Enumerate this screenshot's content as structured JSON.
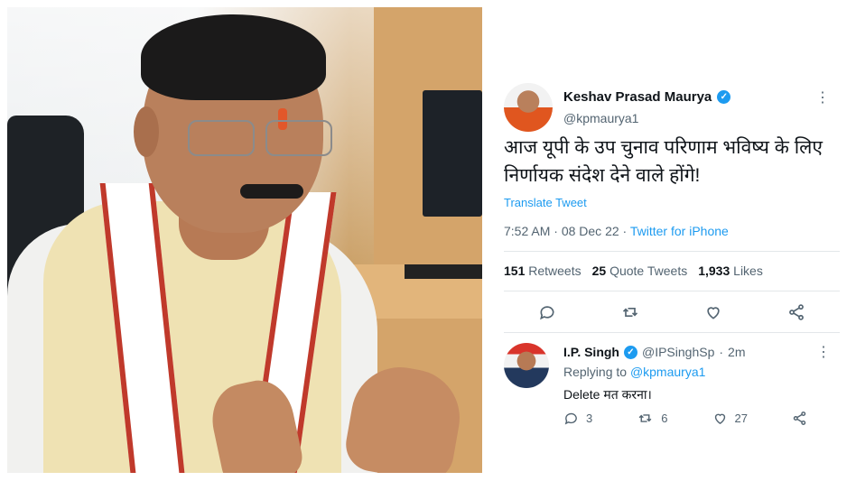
{
  "tweet": {
    "author_name": "Keshav Prasad Maurya",
    "author_handle": "@kpmaurya1",
    "text": "आज यूपी के उप चुनाव परिणाम भविष्य के लिए निर्णायक संदेश देने वाले होंगे!",
    "translate_label": "Translate Tweet",
    "time": "7:52 AM",
    "separator": " · ",
    "date": "08 Dec 22",
    "source": "Twitter for iPhone",
    "stats": {
      "retweets_count": "151",
      "retweets_label": "Retweets",
      "quotes_count": "25",
      "quotes_label": "Quote Tweets",
      "likes_count": "1,933",
      "likes_label": "Likes"
    },
    "actions": [
      "reply-icon",
      "retweet-icon",
      "like-icon",
      "share-icon"
    ]
  },
  "reply": {
    "author_name": "I.P. Singh",
    "author_handle": "@IPSinghSp",
    "dot": "·",
    "age": "2m",
    "replying_label": "Replying to",
    "replying_to": "@kpmaurya1",
    "text": "Delete मत करना।",
    "reply_count": "3",
    "retweet_count": "6",
    "like_count": "27"
  },
  "colors": {
    "accent": "#1d9bf0",
    "secondary_text": "#536471",
    "primary_text": "#0f1419"
  }
}
